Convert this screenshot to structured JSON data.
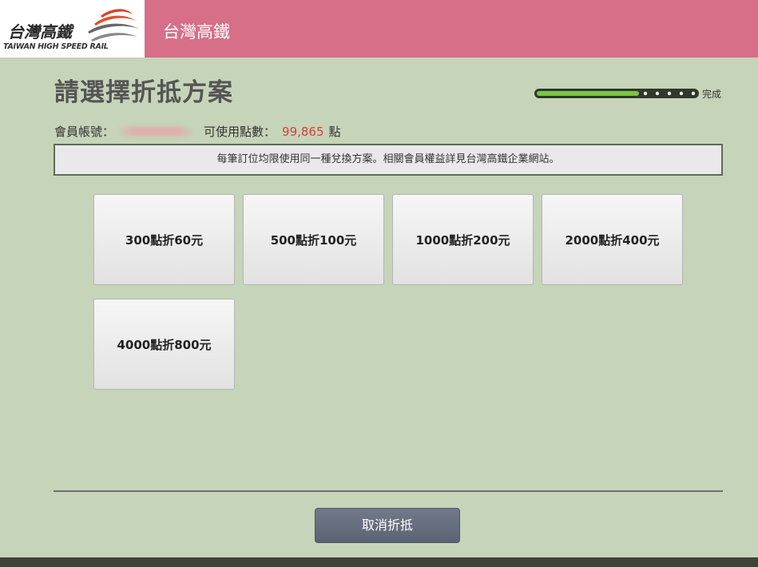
{
  "header": {
    "logo_name": "台灣高鐵",
    "logo_subtitle": "TAIWAN HIGH SPEED RAIL",
    "title": "台灣高鐵",
    "brand_color": "#d76f88"
  },
  "page": {
    "title": "請選擇折抵方案"
  },
  "progress": {
    "label": "完成",
    "completed_fraction": 0.64,
    "remaining_steps": 5
  },
  "member": {
    "account_label": "會員帳號：",
    "points_label": "可使用點數：",
    "points_value": "99,865",
    "points_unit": "點"
  },
  "notice": {
    "text": "每筆訂位均限使用同一種兌換方案。相關會員權益詳見台灣高鐵企業網站。"
  },
  "plans": [
    {
      "label": "300點折60元"
    },
    {
      "label": "500點折100元"
    },
    {
      "label": "1000點折200元"
    },
    {
      "label": "2000點折400元"
    },
    {
      "label": "4000點折800元"
    }
  ],
  "actions": {
    "cancel_label": "取消折抵"
  },
  "icons": {
    "logo": "thsr-swoosh-logo-icon"
  }
}
